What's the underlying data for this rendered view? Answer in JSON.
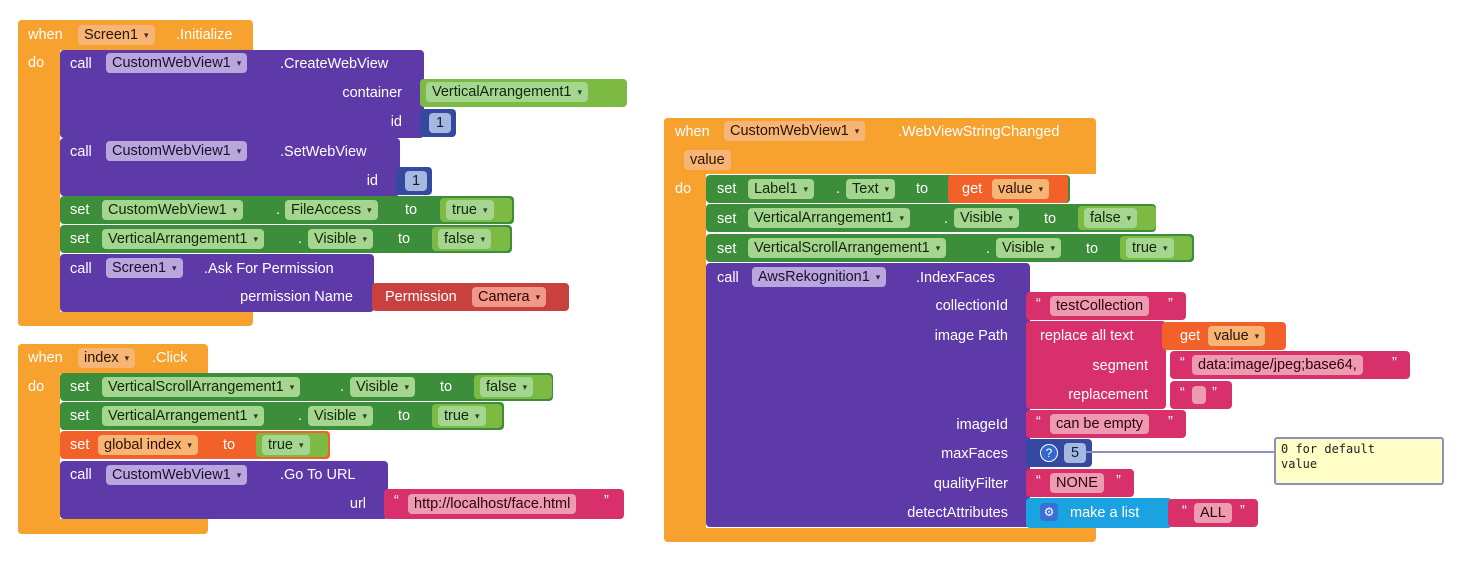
{
  "labels": {
    "when": "when",
    "do": "do",
    "call": "call",
    "set": "set",
    "to": "to",
    "get": "get",
    "dot": ".",
    "open_quote": "“",
    "close_quote": "”"
  },
  "block1": {
    "component": "Screen1",
    "event": ".Initialize",
    "s1_component": "CustomWebView1",
    "s1_method": ".CreateWebView",
    "s1_arg1": "container",
    "s1_arg1_value": "VerticalArrangement1",
    "s1_arg2": "id",
    "s1_arg2_value": "1",
    "s2_component": "CustomWebView1",
    "s2_method": ".SetWebView",
    "s2_arg1": "id",
    "s2_arg1_value": "1",
    "s3_component": "CustomWebView1",
    "s3_prop": "FileAccess",
    "s3_value": "true",
    "s4_component": "VerticalArrangement1",
    "s4_prop": "Visible",
    "s4_value": "false",
    "s5_component": "Screen1",
    "s5_method": ".Ask For Permission",
    "s5_arg1": "permission Name",
    "s5_perm_label": "Permission",
    "s5_perm_value": "Camera"
  },
  "block2": {
    "component": "index",
    "event": ".Click",
    "s1_component": "VerticalScrollArrangement1",
    "s1_prop": "Visible",
    "s1_value": "false",
    "s2_component": "VerticalArrangement1",
    "s2_prop": "Visible",
    "s2_value": "true",
    "s3_var": "global index",
    "s3_value": "true",
    "s4_component": "CustomWebView1",
    "s4_method": ".Go To URL",
    "s4_arg1": "url",
    "s4_url": "http://localhost/face.html"
  },
  "block3": {
    "component": "CustomWebView1",
    "event": ".WebViewStringChanged",
    "param": "value",
    "s1_component": "Label1",
    "s1_prop": "Text",
    "s1_get": "value",
    "s2_component": "VerticalArrangement1",
    "s2_prop": "Visible",
    "s2_value": "false",
    "s3_component": "VerticalScrollArrangement1",
    "s3_prop": "Visible",
    "s3_value": "true",
    "s4_component": "AwsRekognition1",
    "s4_method": ".IndexFaces",
    "arg_collection": "collectionId",
    "val_collection": "testCollection",
    "arg_imagepath": "image Path",
    "replace_label": "replace all text",
    "replace_get": "value",
    "arg_segment": "segment",
    "val_segment": "data:image/jpeg;base64,",
    "arg_replacement": "replacement",
    "arg_imageid": "imageId",
    "val_imageid": "can be empty",
    "arg_maxfaces": "maxFaces",
    "val_maxfaces": "5",
    "arg_quality": "qualityFilter",
    "val_quality": "NONE",
    "arg_detect": "detectAttributes",
    "make_list": "make a list",
    "val_detect": "ALL",
    "comment": "0 for default\nvalue"
  },
  "colors": {
    "event": "#f7a22e",
    "procedure": "#5d3aa8",
    "setter": "#3c8e3a",
    "text": "#d8306a",
    "math": "#3549a0",
    "variable": "#f3612a",
    "list": "#1aa3e0"
  }
}
